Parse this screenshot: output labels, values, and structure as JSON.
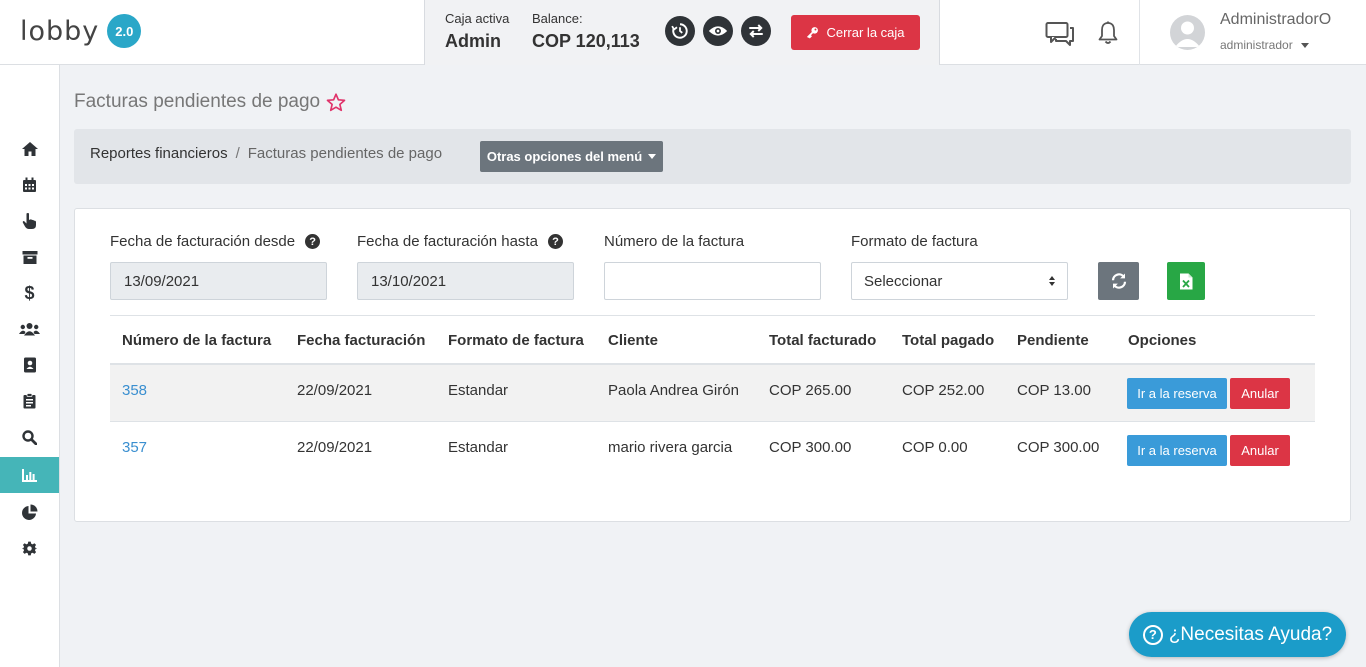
{
  "brand": {
    "logo": "lobby",
    "version": "2.0"
  },
  "cashbox": {
    "active_label": "Caja activa",
    "active_value": "Admin",
    "balance_label": "Balance:",
    "balance_value": "COP 120,113",
    "close_label": "Cerrar la caja"
  },
  "user": {
    "name": "AdministradorO",
    "role": "administrador"
  },
  "sidebar": {
    "items": [
      {
        "icon": "home-icon"
      },
      {
        "icon": "calendar-icon"
      },
      {
        "icon": "hand-pointer-icon"
      },
      {
        "icon": "archive-icon"
      },
      {
        "icon": "dollar-icon"
      },
      {
        "icon": "users-icon"
      },
      {
        "icon": "address-book-icon"
      },
      {
        "icon": "clipboard-icon"
      },
      {
        "icon": "search-icon"
      },
      {
        "icon": "bar-chart-icon",
        "active": true
      },
      {
        "icon": "pie-chart-icon"
      },
      {
        "icon": "gear-icon"
      }
    ]
  },
  "page": {
    "title": "Facturas pendientes de pago"
  },
  "breadcrumb": {
    "parent": "Reportes financieros",
    "separator": "/",
    "current": "Facturas pendientes de pago",
    "menu_label": "Otras opciones del menú"
  },
  "filters": {
    "date_from_label": "Fecha de facturación desde",
    "date_from_value": "13/09/2021",
    "date_to_label": "Fecha de facturación hasta",
    "date_to_value": "13/10/2021",
    "invoice_number_label": "Número de la factura",
    "invoice_number_value": "",
    "format_label": "Formato de factura",
    "format_value": "Seleccionar"
  },
  "table": {
    "headers": [
      "Número de la factura",
      "Fecha facturación",
      "Formato de factura",
      "Cliente",
      "Total facturado",
      "Total pagado",
      "Pendiente",
      "Opciones"
    ],
    "rows": [
      {
        "number": "358",
        "date": "22/09/2021",
        "format": "Estandar",
        "client": "Paola Andrea Girón",
        "total": "COP 265.00",
        "paid": "COP 252.00",
        "pending": "COP 13.00"
      },
      {
        "number": "357",
        "date": "22/09/2021",
        "format": "Estandar",
        "client": "mario rivera garcia",
        "total": "COP 300.00",
        "paid": "COP 0.00",
        "pending": "COP 300.00"
      }
    ],
    "btn_reserve": "Ir a la reserva",
    "btn_cancel": "Anular"
  },
  "help": {
    "label": "¿Necesitas Ayuda?"
  },
  "colors": {
    "accent": "#45b5b8",
    "danger": "#dc3545",
    "info": "#3a9bd9",
    "success": "#28a745",
    "secondary": "#6c757d",
    "help": "#1b9cc9"
  }
}
